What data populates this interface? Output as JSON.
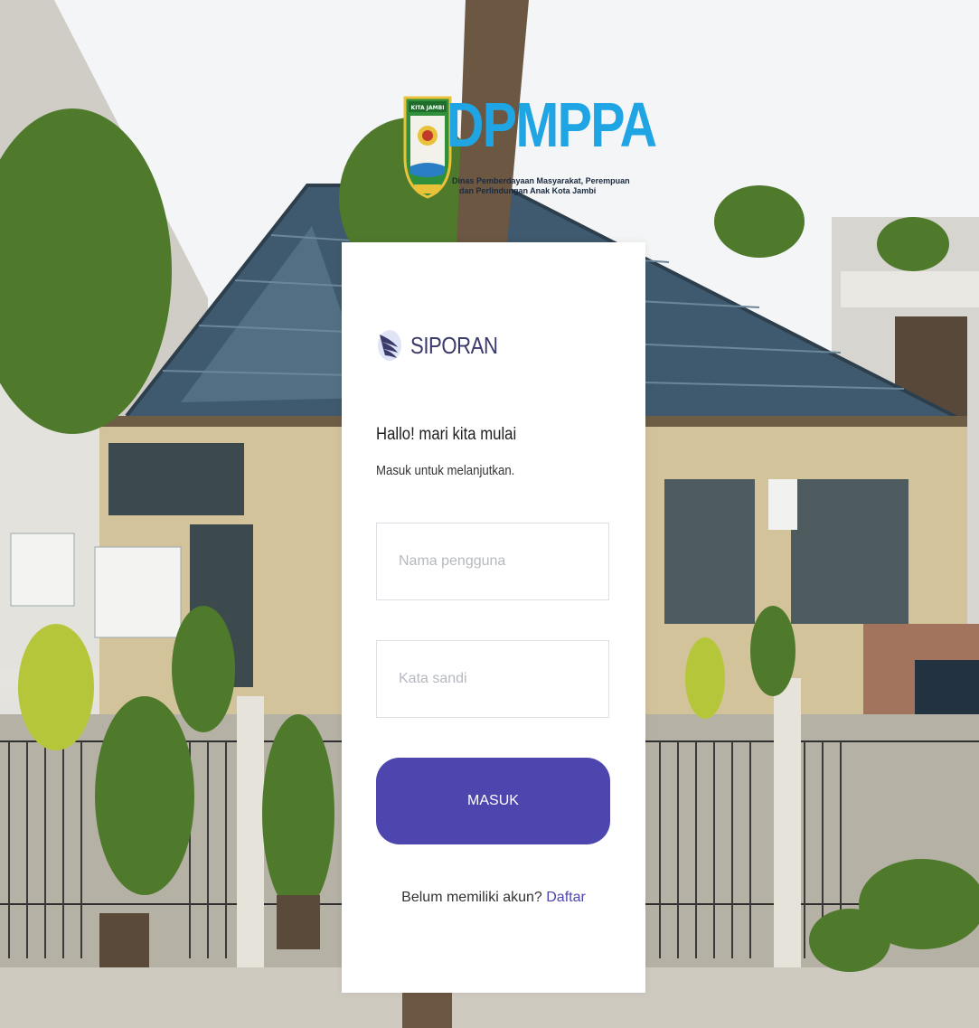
{
  "header": {
    "title": "DPMPPA",
    "subtitle_line1": "Dinas Pemberdayaan Masyarakat, Perempuan",
    "subtitle_line2": "dan Perlindungan Anak Kota Jambi",
    "emblem_text": "KITA JAMBI"
  },
  "brand": {
    "name": "SIPORAN",
    "icon": "siporan-wing-icon"
  },
  "login": {
    "greeting": "Hallo! mari kita mulai",
    "subtitle": "Masuk untuk melanjutkan.",
    "username_placeholder": "Nama pengguna",
    "password_placeholder": "Kata sandi",
    "submit_label": "MASUK",
    "register_prompt": "Belum memiliki akun?",
    "register_link": "Daftar"
  },
  "colors": {
    "accent": "#4d46ae",
    "brand_text": "#3b3a6c",
    "logo_blue": "#1fa5e3"
  }
}
